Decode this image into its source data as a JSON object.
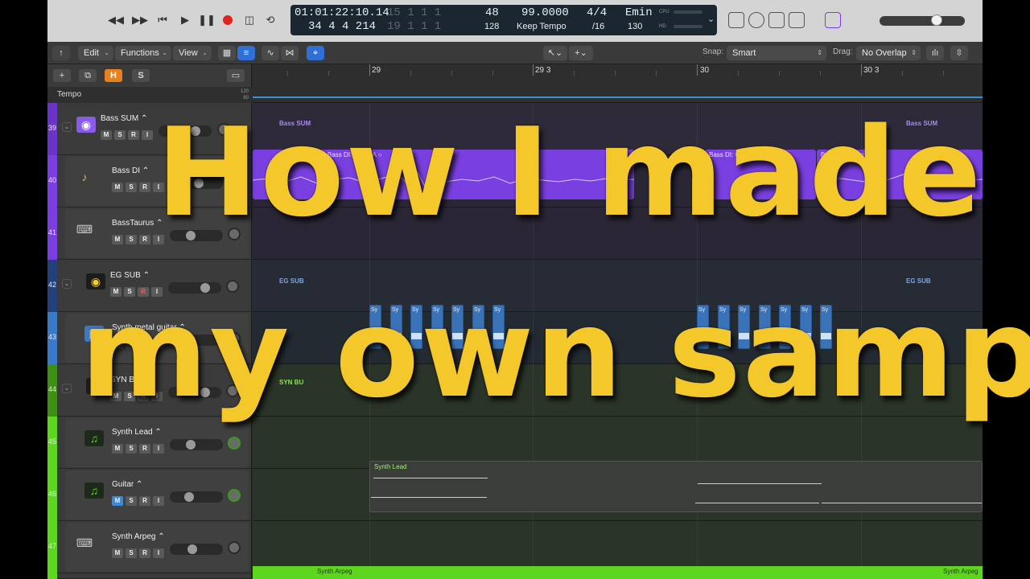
{
  "transport": {
    "position_time": "01:01:22:10.14",
    "position_bars": "34  4  4  214",
    "end_top": "15  1  1  1",
    "end_bottom": "19  1  1  1",
    "tempo_top": "48",
    "tempo_bottom": "128",
    "bpm": "99.0000",
    "tempo_mode": "Keep Tempo",
    "signature": "4/4",
    "division": "/16",
    "key": "Emin",
    "key_bottom": "130",
    "cpu_label": "CPU",
    "hd_label": "HD"
  },
  "toolbar": {
    "edit": "Edit",
    "functions": "Functions",
    "view": "View",
    "snap_label": "Snap:",
    "snap_value": "Smart",
    "drag_label": "Drag:",
    "drag_value": "No Overlap"
  },
  "header": {
    "h_button": "H",
    "s_button": "S",
    "tempo_label": "Tempo",
    "tempo_hi": "120",
    "tempo_lo": "80"
  },
  "ruler": {
    "bars": [
      "29",
      "29 3",
      "30",
      "30 3"
    ]
  },
  "tracks": [
    {
      "num": "39",
      "name": "Bass SUM",
      "color": "#7a3fe0"
    },
    {
      "num": "40",
      "name": "Bass DI",
      "color": "#7a3fe0"
    },
    {
      "num": "41",
      "name": "BassTaurus",
      "color": "#7a3fe0"
    },
    {
      "num": "42",
      "name": "EG SUB",
      "color": "#2a4a8a"
    },
    {
      "num": "43",
      "name": "Synth metal guitar",
      "color": "#3a78c8"
    },
    {
      "num": "44",
      "name": "SYN BUS",
      "color": "#4caf1a"
    },
    {
      "num": "45",
      "name": "Synth Lead",
      "color": "#5cd61e"
    },
    {
      "num": "46",
      "name": "Guitar",
      "color": "#5cd61e"
    },
    {
      "num": "47",
      "name": "Synth Arpeg",
      "color": "#5cd61e"
    }
  ],
  "regions": {
    "bass_sum_label": "Bass SUM",
    "bass_di_label": "Bass DI: Comp A",
    "eg_sub_label": "EG SUB",
    "syn_bus_label": "SYN BU",
    "sy_label": "Sy",
    "synth_lead_label": "Synth Lead",
    "synth_arpeg_label": "Synth Arpeg"
  },
  "colors": {
    "bass": "#7a3fe0",
    "eg": "#3a72b8",
    "synth": "#5cd61e",
    "overlay_text": "#f4c72b"
  },
  "overlay": {
    "line1": "How I made",
    "line2": "my own sample"
  }
}
